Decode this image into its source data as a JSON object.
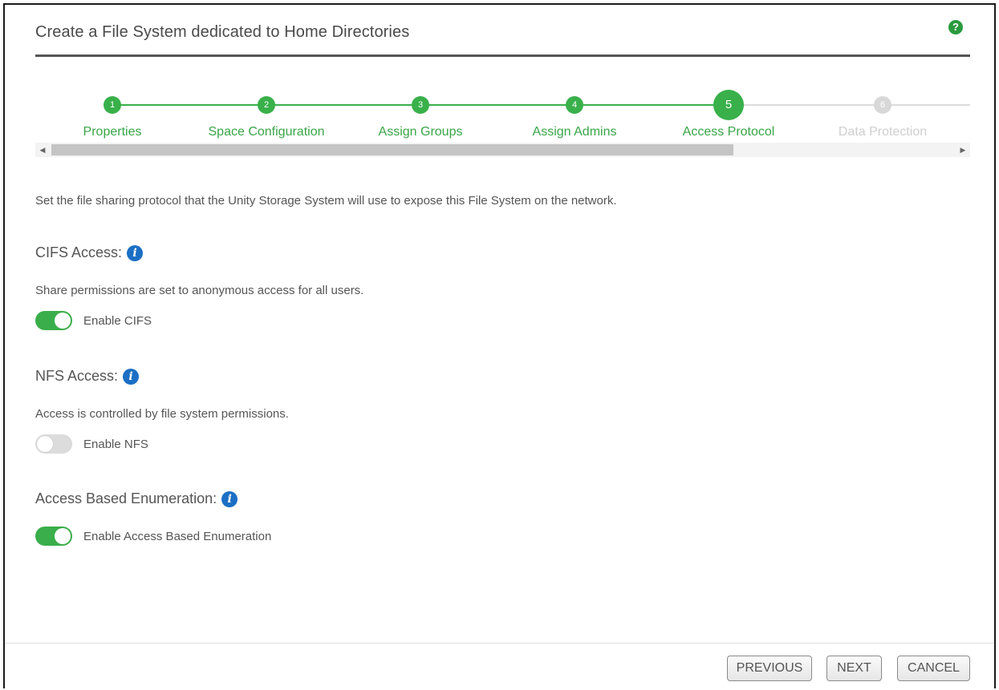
{
  "dialog": {
    "title": "Create a File System dedicated to Home Directories",
    "help_icon": "?"
  },
  "stepper": {
    "steps": [
      {
        "number": "1",
        "label": "Properties",
        "state": "completed"
      },
      {
        "number": "2",
        "label": "Space Configuration",
        "state": "completed"
      },
      {
        "number": "3",
        "label": "Assign Groups",
        "state": "completed"
      },
      {
        "number": "4",
        "label": "Assign Admins",
        "state": "completed"
      },
      {
        "number": "5",
        "label": "Access Protocol",
        "state": "current"
      },
      {
        "number": "6",
        "label": "Data Protection",
        "state": "disabled"
      }
    ],
    "scroll_left_icon": "◀",
    "scroll_right_icon": "▶"
  },
  "content": {
    "intro": "Set the file sharing protocol that the Unity Storage System will use to expose this File System on the network.",
    "cifs": {
      "title": "CIFS Access:",
      "description": "Share permissions are set to anonymous access for all users.",
      "toggle_label": "Enable CIFS",
      "enabled": true
    },
    "nfs": {
      "title": "NFS Access:",
      "description": "Access is controlled by file system permissions.",
      "toggle_label": "Enable NFS",
      "enabled": false
    },
    "abe": {
      "title": "Access Based Enumeration:",
      "toggle_label": "Enable Access Based Enumeration",
      "enabled": true
    },
    "info_icon_glyph": "i"
  },
  "footer": {
    "previous_label": "PREVIOUS",
    "next_label": "NEXT",
    "cancel_label": "CANCEL"
  },
  "colors": {
    "accent_green": "#39b04a",
    "info_blue": "#1b6fc4",
    "disabled_gray": "#cfcfcf"
  }
}
